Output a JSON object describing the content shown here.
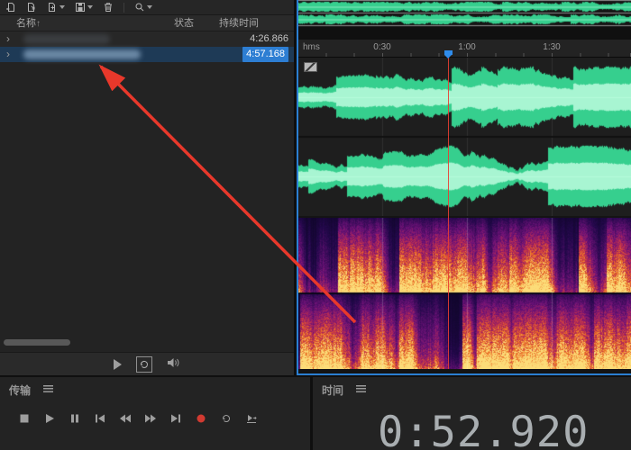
{
  "files_panel": {
    "toolbar_icons": [
      "import-file",
      "open-file",
      "new-content",
      "save",
      "delete",
      "search"
    ],
    "columns": {
      "name": "名称",
      "status": "状态",
      "duration": "持续时间"
    },
    "sort_indicator": "↑",
    "twirl": "›",
    "rows": [
      {
        "name_redacted": true,
        "duration": "4:26.866",
        "selected": false
      },
      {
        "name_redacted": true,
        "duration": "4:57.168",
        "selected": true
      }
    ],
    "bottom_icons": [
      "play",
      "loop",
      "speaker"
    ]
  },
  "editor": {
    "timeline": {
      "unit": "hms",
      "ticks": [
        "0:30",
        "1:00",
        "1:30"
      ]
    }
  },
  "transport": {
    "title": "传输",
    "buttons": [
      "stop",
      "play",
      "pause",
      "previous",
      "rewind",
      "fast-forward",
      "next",
      "record",
      "loop",
      "skip-selection"
    ]
  },
  "time_panel": {
    "title": "时间",
    "value": "0:52.920"
  },
  "colors": {
    "waveform_outer": "#36cf8e",
    "waveform_inner": "#a8f5d2",
    "selection_blue": "#2d7ed3",
    "playhead_red": "#e8382b",
    "panel_border_blue": "#2b7fd2",
    "record_red": "#d23a31"
  }
}
